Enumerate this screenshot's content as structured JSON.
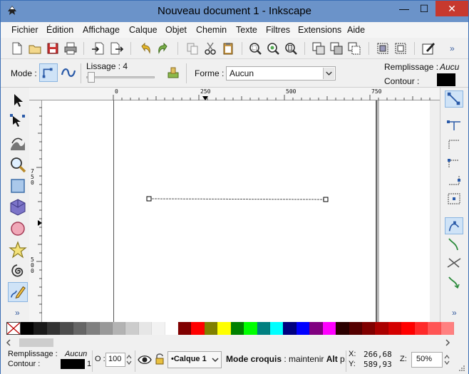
{
  "window": {
    "title": "Nouveau document 1 - Inkscape",
    "minimize_glyph": "—",
    "maximize_glyph": "☐",
    "close_glyph": "✕"
  },
  "menu": [
    "Fichier",
    "Édition",
    "Affichage",
    "Calque",
    "Objet",
    "Chemin",
    "Texte",
    "Filtres",
    "Extensions",
    "Aide"
  ],
  "toolbar1_overflow": "»",
  "tool_controls": {
    "mode_label": "Mode :",
    "smoothing_label": "Lissage : 4",
    "shape_label": "Forme :",
    "shape_value": "Aucun",
    "fill_label": "Remplissage :",
    "fill_value": "Aucu",
    "stroke_label": "Contour :"
  },
  "ruler": {
    "top_labels": [
      "0",
      "250",
      "500",
      "750"
    ],
    "left_labels": [
      "750",
      "500"
    ]
  },
  "left_tools_more": "»",
  "right_tools_more": "»",
  "palette_colors": [
    "#000000",
    "#1a1a1a",
    "#333333",
    "#4d4d4d",
    "#666666",
    "#808080",
    "#999999",
    "#b3b3b3",
    "#cccccc",
    "#e6e6e6",
    "#f2f2f2",
    "#ffffff",
    "#800000",
    "#ff0000",
    "#808000",
    "#ffff00",
    "#008000",
    "#00ff00",
    "#008080",
    "#00ffff",
    "#000080",
    "#0000ff",
    "#800080",
    "#ff00ff",
    "#2b0000",
    "#550000",
    "#800000",
    "#aa0000",
    "#d40000",
    "#ff0000",
    "#ff2a2a",
    "#ff5555",
    "#ff8080"
  ],
  "status": {
    "fill_label": "Remplissage :",
    "fill_value": "Aucun",
    "stroke_label": "Contour :",
    "stroke_width": "1",
    "opacity_label": "O :",
    "opacity_value": "100",
    "layer_value": "•Calque 1",
    "message_bold": "Mode croquis",
    "message_rest": " : maintenir ",
    "message_key": "Alt",
    "message_tail": " p.",
    "x_label": "X:",
    "x_value": "266,68",
    "y_label": "Y:",
    "y_value": "589,93",
    "zoom_label": "Z:",
    "zoom_value": "50%"
  }
}
